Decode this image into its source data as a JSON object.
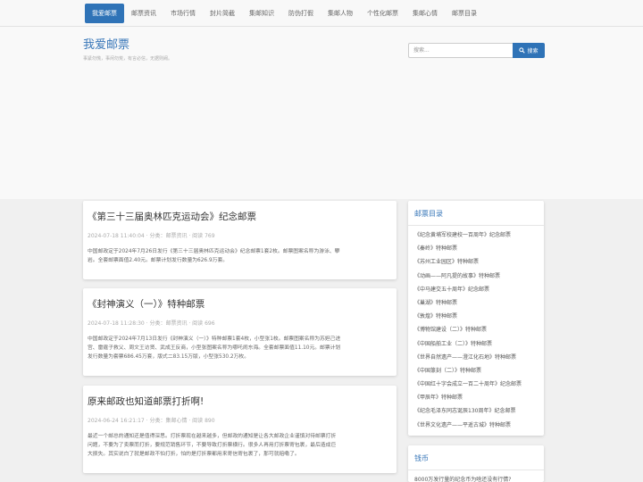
{
  "nav": {
    "items": [
      {
        "label": "我爱邮票",
        "active": true
      },
      {
        "label": "邮票资讯",
        "active": false
      },
      {
        "label": "市场行情",
        "active": false
      },
      {
        "label": "封片简截",
        "active": false
      },
      {
        "label": "集邮知识",
        "active": false
      },
      {
        "label": "防伪打假",
        "active": false
      },
      {
        "label": "集邮人物",
        "active": false
      },
      {
        "label": "个性化邮票",
        "active": false
      },
      {
        "label": "集邮心情",
        "active": false
      },
      {
        "label": "邮票目录",
        "active": false
      }
    ]
  },
  "header": {
    "title": "我爱邮票",
    "tagline": "事紧勿慌，事闲勿荒，有言必信，无据则阙。"
  },
  "search": {
    "placeholder": "搜索...",
    "button_label": "搜索"
  },
  "articles": [
    {
      "title": "《第三十三届奥林匹克运动会》纪念邮票",
      "meta": "2024-07-18 11:40:04 · 分类：邮票资讯 · 阅读 769",
      "lines": [
        "中国邮政定于2024年7月26日发行《第三十三届奥林匹克运动会》纪念邮票1套2枚。邮票图案名称为游泳、攀",
        "岩。全套邮票面值2.40元。邮票计划发行数量为626.9万套。"
      ]
    },
    {
      "title": "《封神演义（一）》特种邮票",
      "meta": "2024-07-18 11:28:30 · 分类：邮票资讯 · 阅读 696",
      "lines": [
        "中国邮政定于2024年7月13日发行《封神演义（一）》特种邮票1套4枚，小型张1枚。邮票图案名称为苏妲己进",
        "宫、雷霆子救父、周文王访贤、武成王反商，小型张图案名称为哪吒闹东海。全套邮票面值11.10元。邮票计划",
        "发行数量为套票686.45万套，版式二83.15万版，小型张530.2万枚。"
      ]
    },
    {
      "title": "原来邮政也知道邮票打折啊!",
      "meta": "2024-06-24 16:21:17 · 分类：集邮心情 · 阅读 890",
      "lines": [
        "最近一个邮总的通知还是值得深思。打折票现在越来越多，但邮政的通知是让各大邮政企业谨慎对待邮票打折",
        "问题，不要为了卖票而打折，要规范销售环节，不要导致打折票横行。很多人再用打折票寄包裹，最后造成巨",
        "大损失。其实说白了就是邮政不怕打折，怕的是打折票都用来寄信寄包裹了，那可就赔嘞了。"
      ]
    }
  ],
  "sidebar_catalog": {
    "title": "邮票目录",
    "items": [
      "《纪念黄埔军校建校一百周年》纪念邮票",
      "《秦岭》特种邮票",
      "《苏州工业园区》特种邮票",
      "《动画——阿凡提的故事》特种邮票",
      "《中马建交五十周年》纪念邮票",
      "《巢湖》特种邮票",
      "《敦煌》特种邮票",
      "《博物馆建设（二）》特种邮票",
      "《中国船舶工业（二）》特种邮票",
      "《世界自然遗产——澄江化石地》特种邮票",
      "《中国篆刻（二）》特种邮票",
      "《中国红十字会成立一百二十周年》纪念邮票",
      "《甲辰年》特种邮票",
      "《纪念毛泽东同志诞辰130周年》纪念邮票",
      "《世界文化遗产——平遥古城》特种邮票"
    ]
  },
  "sidebar_coins": {
    "title": "钱币",
    "items": [
      "8000万发行量的纪念币为啥还没有行情?"
    ]
  }
}
